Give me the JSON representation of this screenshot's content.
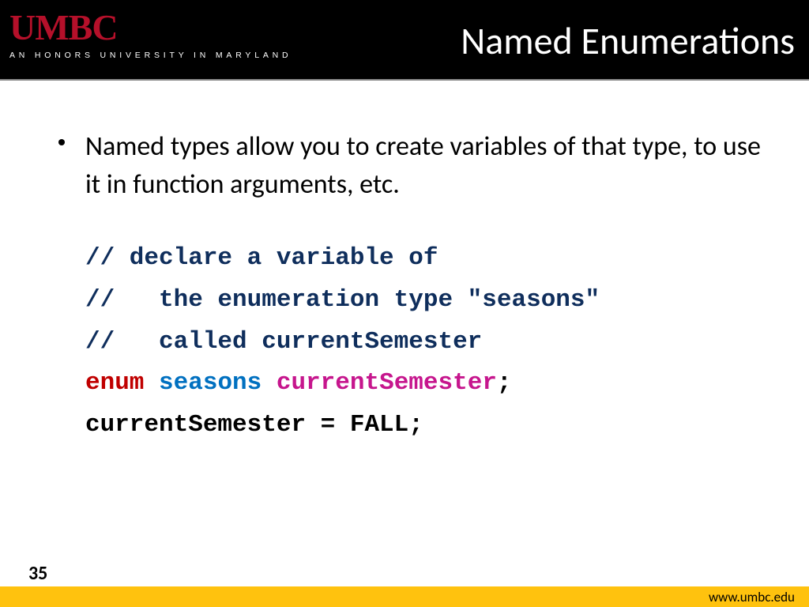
{
  "header": {
    "logo": "UMBC",
    "tagline": "AN HONORS UNIVERSITY IN MARYLAND",
    "title": "Named Enumerations"
  },
  "content": {
    "bullet": "Named types allow you to create variables of that type, to use it in function arguments, etc.",
    "code": {
      "c1": "// declare a variable of",
      "c2": "//   the enumeration type \"seasons\"",
      "c3": "//   called currentSemester",
      "kw": "enum",
      "ty": "seasons",
      "id": "currentSemester",
      "semi": ";",
      "assign": "currentSemester = FALL;"
    }
  },
  "footer": {
    "page": "35",
    "url": "www.umbc.edu"
  }
}
